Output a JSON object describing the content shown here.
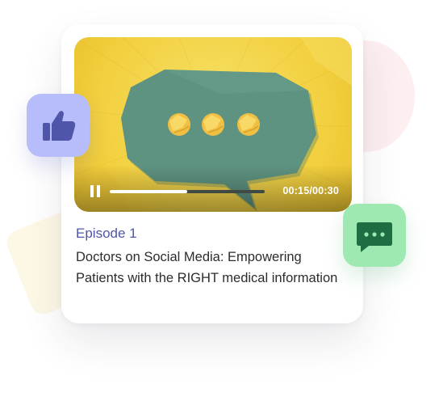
{
  "player": {
    "current_time": "00:15",
    "duration": "00:30",
    "time_display": "00:15/00:30",
    "progress": 0.5,
    "state": "playing",
    "control_icon": "pause-icon"
  },
  "episode": {
    "label": "Episode 1",
    "title": "Doctors on Social Media: Empowering Patients with the RIGHT medical information"
  },
  "badges": {
    "like_icon": "thumbs-up-icon",
    "chat_icon": "chat-bubble-icon"
  },
  "colors": {
    "accent": "#4f55a8",
    "like_badge": "#b7bdfa",
    "chat_badge": "#9ee8b1",
    "video_background": "#f2cf3d",
    "speech_bubble": "#5f9381"
  }
}
